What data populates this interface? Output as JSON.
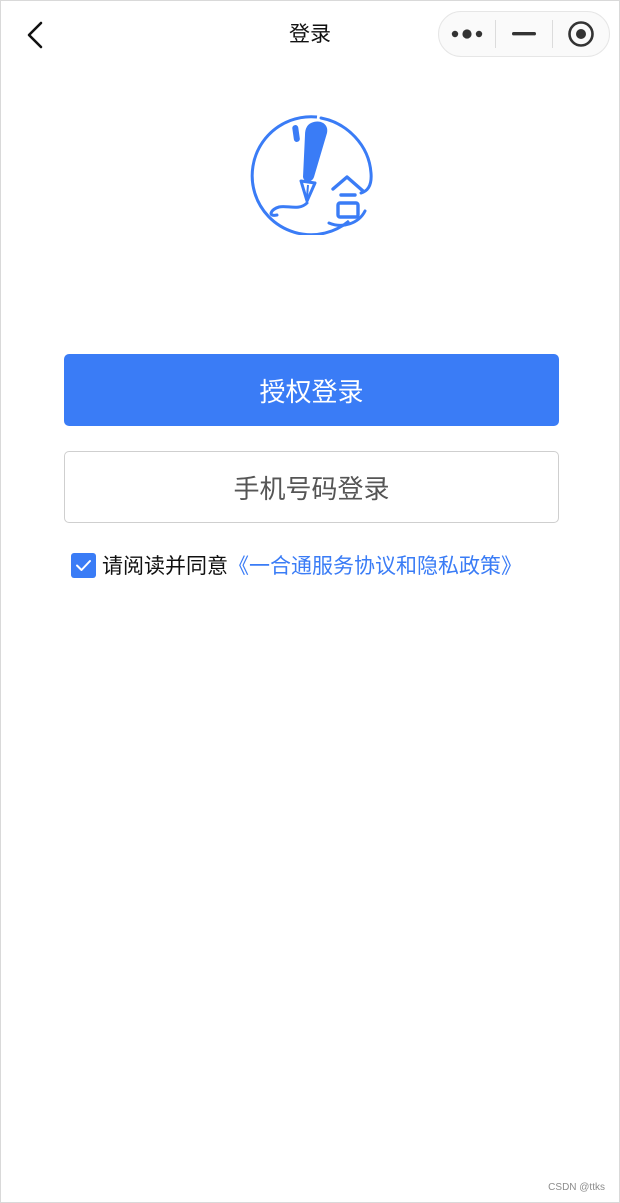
{
  "navbar": {
    "title": "登录",
    "back_icon": "chevron-left-icon",
    "capsule": {
      "more_icon": "more-dots-icon",
      "minimize_icon": "minimize-icon",
      "close_icon": "target-circle-icon"
    }
  },
  "logo": {
    "icon": "pen-logo-icon",
    "glyph": "合",
    "color": "#3a7cf6"
  },
  "buttons": {
    "authorize_label": "授权登录",
    "phone_label": "手机号码登录"
  },
  "agreement": {
    "checked": true,
    "prefix": "请阅读并同意",
    "link": "《一合通服务协议和隐私政策》"
  },
  "watermark": "CSDN @ttks",
  "colors": {
    "primary": "#3a7cf6",
    "text": "#111111",
    "secondary_text": "#555555",
    "border": "#cfcfcf"
  }
}
